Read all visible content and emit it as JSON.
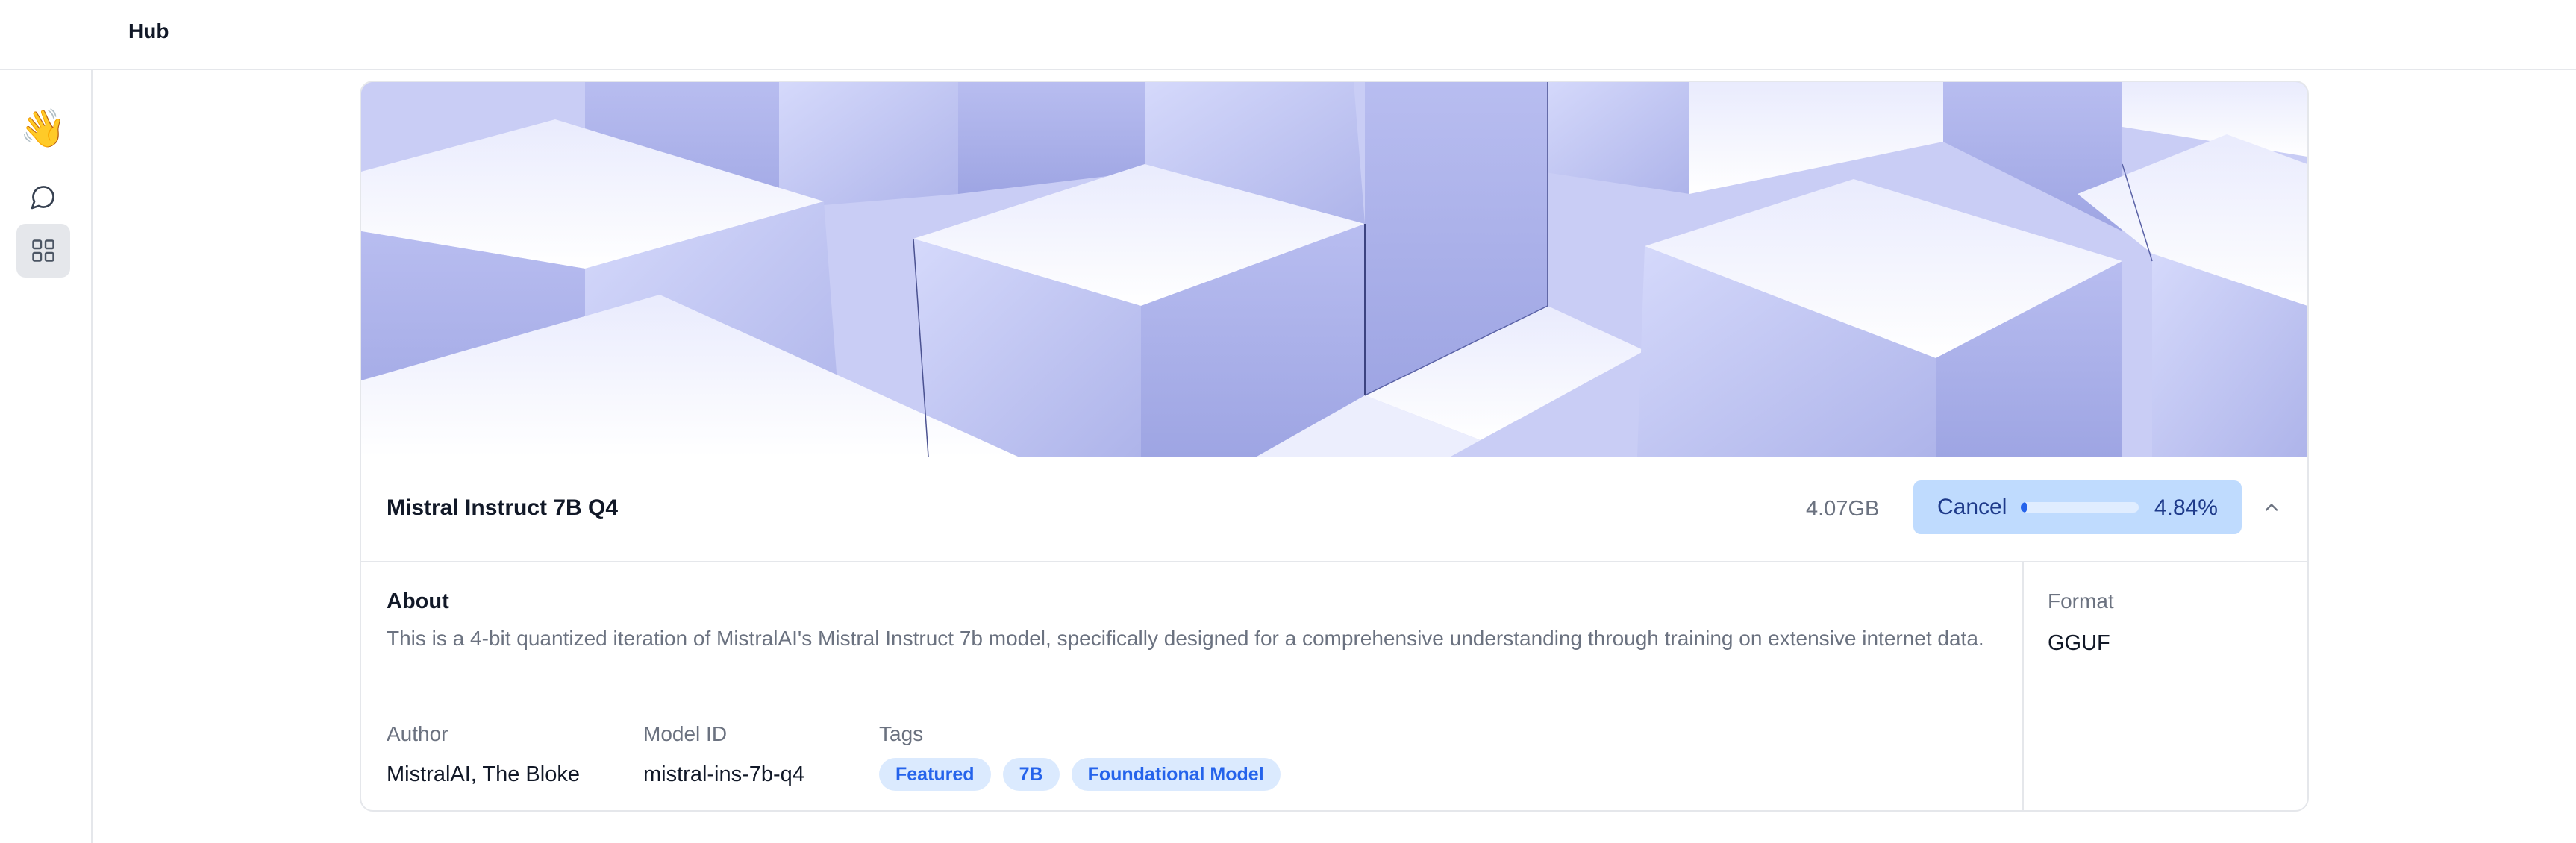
{
  "header": {
    "title": "Hub"
  },
  "sidebar": {
    "items": [
      {
        "icon": "waving-hand-icon",
        "glyph": "👋"
      },
      {
        "icon": "chat-bubble-icon"
      },
      {
        "icon": "grid-icon",
        "active": true
      }
    ]
  },
  "model": {
    "name": "Mistral Instruct 7B Q4",
    "size": "4.07GB",
    "cancel_label": "Cancel",
    "progress_percent": 4.84,
    "progress_text": "4.84%",
    "about_title": "About",
    "about_text": "This is a 4-bit quantized iteration of MistralAI's Mistral Instruct 7b model, specifically designed for a comprehensive understanding through training on extensive internet data.",
    "author_label": "Author",
    "author": "MistralAI, The Bloke",
    "model_id_label": "Model ID",
    "model_id": "mistral-ins-7b-q4",
    "tags_label": "Tags",
    "tags": [
      "Featured",
      "7B",
      "Foundational Model"
    ],
    "format_label": "Format",
    "format": "GGUF"
  },
  "colors": {
    "accent": "#2563eb",
    "cancel_bg": "#bfdbfe",
    "tag_bg": "#dbeafe",
    "border": "#e5e7eb"
  }
}
